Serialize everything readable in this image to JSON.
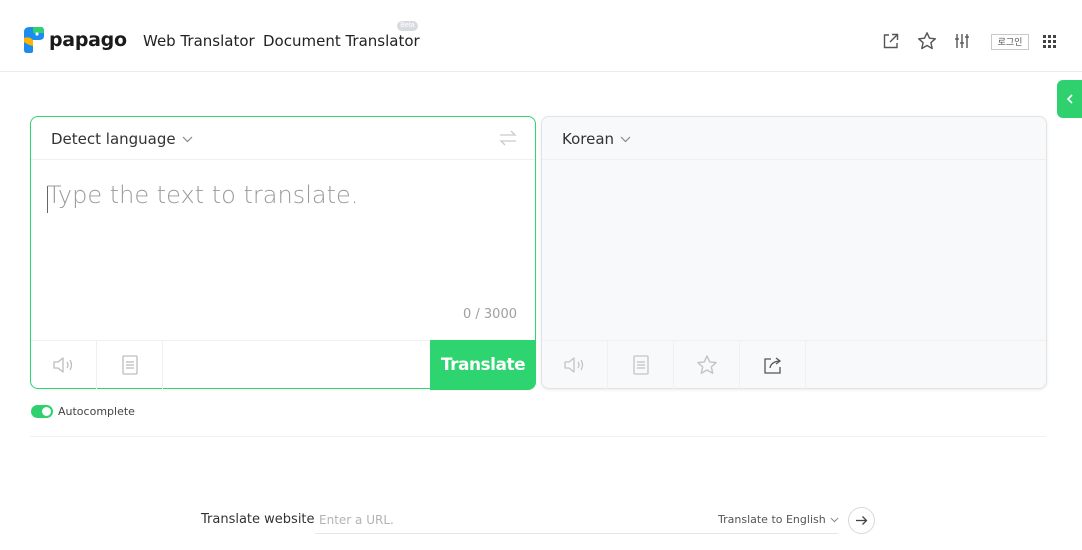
{
  "header": {
    "logo_text": "papago",
    "nav": [
      {
        "label": "Web Translator"
      },
      {
        "label": "Document Translator"
      }
    ],
    "beta_badge": "Beta",
    "icons": [
      "share-out-icon",
      "star-icon",
      "settings-sliders-icon",
      "apps-grid-icon"
    ],
    "login_label": "로그인"
  },
  "source": {
    "language": "Detect language",
    "placeholder": "Type the text to translate.",
    "counter": "0 / 3000",
    "translate_label": "Translate",
    "tools": [
      "speaker-icon",
      "notes-icon"
    ]
  },
  "target": {
    "language": "Korean",
    "tools": [
      "speaker-icon",
      "notes-icon",
      "star-icon",
      "share-icon"
    ]
  },
  "autocomplete": {
    "label": "Autocomplete",
    "enabled": true
  },
  "website": {
    "label": "Translate website",
    "placeholder": "Enter a URL.",
    "target_option": "Translate to English"
  },
  "colors": {
    "accent": "#2dd46f",
    "logo_blue": "#1b8cf0",
    "border": "#e3e3e3"
  }
}
